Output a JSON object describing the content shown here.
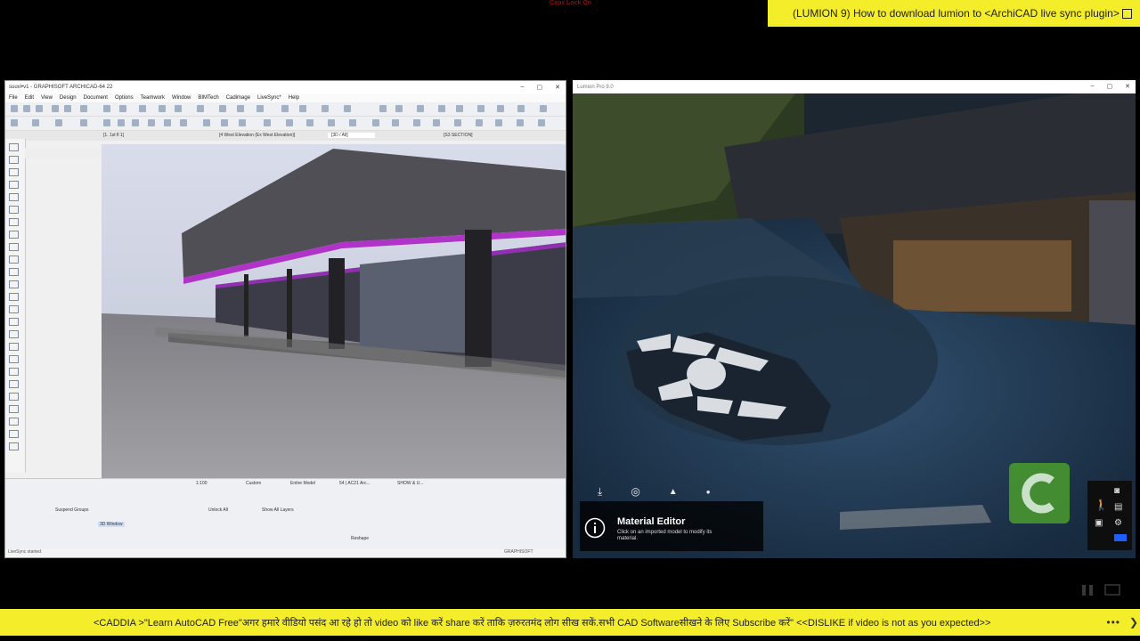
{
  "overlay": {
    "caps_lock": "Caps Lock On"
  },
  "top_banner": {
    "text": "(LUMION 9) How to download lumion to <ArchiCAD live sync plugin>"
  },
  "archicad": {
    "title": "suuvi•v1 - GRAPHISOFT ARCHICAD-64 22",
    "menu": [
      "File",
      "Edit",
      "View",
      "Design",
      "Document",
      "Options",
      "Teamwork",
      "Window",
      "BIMTech",
      "Cadimage",
      "LiveSync*",
      "Help"
    ],
    "tabs": [
      "[1. 1st fl 1]",
      "[4 West Elevation (Ex West Elevation)]",
      "[3D / All]",
      "[S3 SECTION]"
    ],
    "bottom_labels": [
      "Custom",
      "Entire Model",
      "54 | AC21 Arc...",
      "SHOW & U...",
      "1:100",
      "Suspend Groups",
      "Unlock All",
      "Show All Layers",
      "3D Window",
      "Reshape"
    ],
    "status": "LiveSync started.",
    "graphisoft": "GRAPHISOFT"
  },
  "lumion": {
    "title": "Lumion Pro 9.0",
    "material_editor": {
      "title": "Material Editor",
      "desc": "Click on an imported model to modify its material."
    }
  },
  "bottom_banner": {
    "text": "<CADDIA >\"Learn AutoCAD Free\"अगर हमारे वीडियो पसंद आ रहे हो तो video को like करें share करें ताकि ज़रुरतमंद लोग सीख सकें.सभी CAD Softwareसीखने के लिए Subscribe करें\" <<DISLIKE if video is not as you expected>>",
    "dots": "•••",
    "arrow": "❯"
  },
  "colors": {
    "banner_yellow": "#f4ed29",
    "camtasia_green": "#4a9c2e"
  }
}
